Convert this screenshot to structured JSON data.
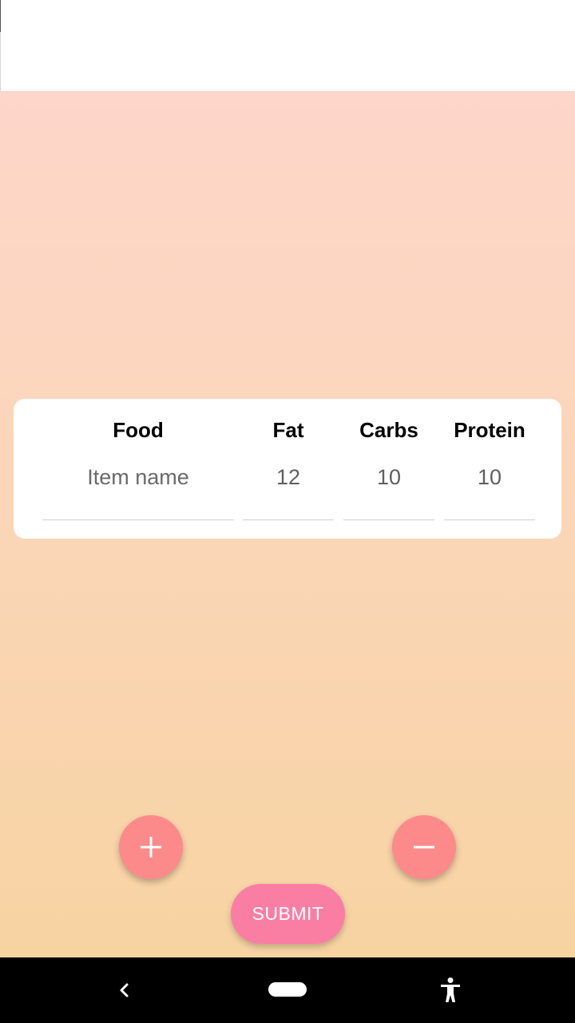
{
  "table": {
    "headers": {
      "food": "Food",
      "fat": "Fat",
      "carbs": "Carbs",
      "protein": "Protein"
    },
    "row": {
      "food_placeholder": "Item name",
      "fat_value": "12",
      "carbs_value": "10",
      "protein_value": "10"
    }
  },
  "actions": {
    "add_icon": "plus-icon",
    "remove_icon": "minus-icon",
    "submit_label": "SUBMIT"
  },
  "navigation": {
    "back_icon": "back-chevron-icon",
    "home_icon": "home-pill-icon",
    "accessibility_icon": "accessibility-icon"
  },
  "colors": {
    "fab": "#fd8a8a",
    "submit": "#fa7ea4",
    "gradient_top": "#fed6ca",
    "gradient_bottom": "#f7d3a2"
  }
}
